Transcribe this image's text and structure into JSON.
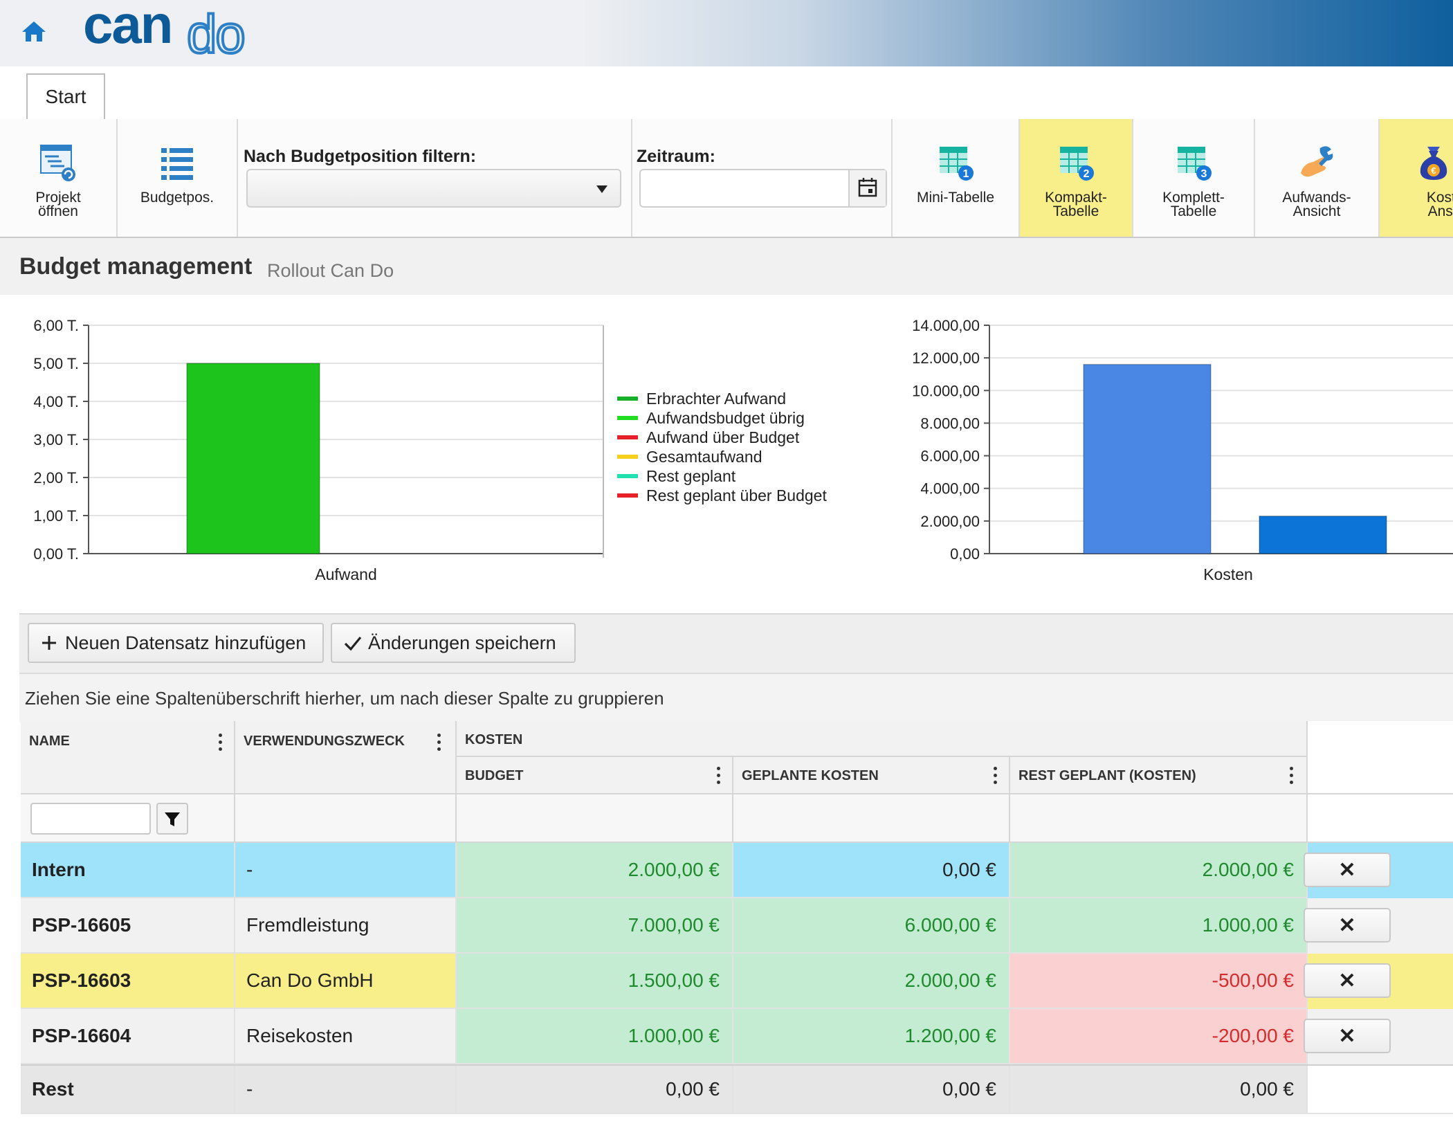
{
  "header": {
    "logo_text": "cando",
    "home_icon": "home-icon"
  },
  "tabs": [
    {
      "label": "Start"
    }
  ],
  "ribbon": {
    "project_open": "Projekt öffnen",
    "budgetpos": "Budgetpos.",
    "filter_label": "Nach Budgetposition filtern:",
    "filter_value": "",
    "period_label": "Zeitraum:",
    "period_value": "",
    "views": [
      {
        "label": "Mini-Tabelle",
        "icon": "table-1-icon",
        "active": false
      },
      {
        "label": "Kompakt-Tabelle",
        "icon": "table-2-icon",
        "active": true
      },
      {
        "label": "Komplett-Tabelle",
        "icon": "table-3-icon",
        "active": false
      },
      {
        "label": "Aufwands-Ansicht",
        "icon": "wrench-hand-icon",
        "active": false
      },
      {
        "label": "Kosten-Ansicht",
        "icon": "money-bag-icon",
        "active": true
      }
    ]
  },
  "page": {
    "title": "Budget management",
    "subtitle": "Rollout Can Do"
  },
  "chart_data": [
    {
      "type": "bar",
      "categories": [
        "Aufwand"
      ],
      "series": [
        {
          "name": "Erbrachter Aufwand",
          "values": [
            5.0
          ],
          "color": "#1cc41c"
        }
      ],
      "ylim": [
        0,
        6
      ],
      "yticks": [
        "0,00 T.",
        "1,00 T.",
        "2,00 T.",
        "3,00 T.",
        "4,00 T.",
        "5,00 T.",
        "6,00 T."
      ],
      "xlabel": "Aufwand",
      "legend": {
        "placement": "right",
        "entries": [
          {
            "name": "Erbrachter Aufwand",
            "color": "#18b02a"
          },
          {
            "name": "Aufwandsbudget übrig",
            "color": "#22dd22"
          },
          {
            "name": "Aufwand über Budget",
            "color": "#e8202a"
          },
          {
            "name": "Gesamtaufwand",
            "color": "#f5d11e"
          },
          {
            "name": "Rest geplant",
            "color": "#22e0b0"
          },
          {
            "name": "Rest geplant über Budget",
            "color": "#e8202a"
          }
        ]
      },
      "grid": true
    },
    {
      "type": "bar",
      "categories": [
        "Kosten"
      ],
      "series": [
        {
          "values": [
            11600
          ],
          "color": "#4a86e4"
        },
        {
          "values": [
            2300
          ],
          "color": "#0b74d6"
        }
      ],
      "ylim": [
        0,
        14000
      ],
      "yticks": [
        "0,00",
        "2.000,00",
        "4.000,00",
        "6.000,00",
        "8.000,00",
        "10.000,00",
        "12.000,00",
        "14.000,00"
      ],
      "xlabel": "Kosten",
      "grid": true
    }
  ],
  "toolbar": {
    "add_label": "Neuen Datensatz hinzufügen",
    "save_label": "Änderungen speichern"
  },
  "group_hint": "Ziehen Sie eine Spaltenüberschrift hierher, um nach dieser Spalte zu gruppieren",
  "columns": {
    "name": "NAME",
    "purpose": "VERWENDUNGSZWECK",
    "costs_group": "KOSTEN",
    "budget": "BUDGET",
    "planned": "GEPLANTE KOSTEN",
    "rest": "REST GEPLANT (KOSTEN)"
  },
  "rows": [
    {
      "name": "Intern",
      "purpose": "-",
      "budget": "2.000,00 €",
      "planned": "0,00 €",
      "rest": "2.000,00 €"
    },
    {
      "name": "PSP-16605",
      "purpose": "Fremdleistung",
      "budget": "7.000,00 €",
      "planned": "6.000,00 €",
      "rest": "1.000,00 €"
    },
    {
      "name": "PSP-16603",
      "purpose": "Can Do GmbH",
      "budget": "1.500,00 €",
      "planned": "2.000,00 €",
      "rest": "-500,00 €"
    },
    {
      "name": "PSP-16604",
      "purpose": "Reisekosten",
      "budget": "1.000,00 €",
      "planned": "1.200,00 €",
      "rest": "-200,00 €"
    }
  ],
  "footer": {
    "name": "Rest",
    "purpose": "-",
    "budget": "0,00 €",
    "planned": "0,00 €",
    "rest": "0,00 €"
  },
  "colors": {
    "row_intern": "#9fe3fb",
    "row_alt": "#f1f1f1",
    "row_highlight": "#f8ee8a",
    "cell_green": "#c3ecd2",
    "cell_red": "#fbd0d0",
    "amount_green": "#1f8a2d",
    "amount_red": "#d42c2c"
  }
}
